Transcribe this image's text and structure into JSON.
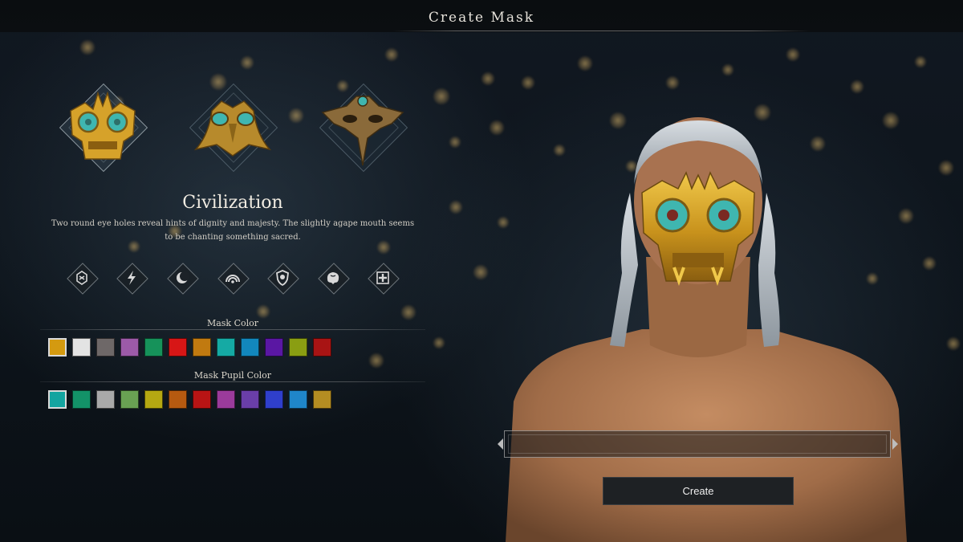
{
  "header": {
    "title": "Create Mask"
  },
  "masks": [
    {
      "icon": "golden-turquoise-eye-mask-icon",
      "selected": true
    },
    {
      "icon": "turquoise-bird-mask-icon",
      "selected": false
    },
    {
      "icon": "bronze-horned-mask-icon",
      "selected": false
    }
  ],
  "selected_mask": {
    "name": "Civilization",
    "description": "Two round eye holes reveal hints of dignity and majesty. The slightly agape mouth seems to be chanting something sacred."
  },
  "attribute_icons": [
    "knot-icon",
    "lightning-icon",
    "moon-icon",
    "rainbow-arc-icon",
    "shield-icon",
    "brain-icon",
    "medical-cross-icon"
  ],
  "mask_color": {
    "label": "Mask Color",
    "selected_index": 0,
    "swatches": [
      "#d49a10",
      "#e3e3e3",
      "#6e6868",
      "#9c5aa8",
      "#16925a",
      "#d71616",
      "#c17a10",
      "#15aaa4",
      "#1287bd",
      "#5a17a3",
      "#8a9e12",
      "#a81414"
    ]
  },
  "pupil_color": {
    "label": "Mask Pupil Color",
    "selected_index": 0,
    "swatches": [
      "#14a4a0",
      "#139268",
      "#a9a9a9",
      "#69a153",
      "#b5a812",
      "#b65a10",
      "#b81414",
      "#9b3b9b",
      "#6a3ea8",
      "#2f3fcc",
      "#1f86c9",
      "#b48d22"
    ]
  },
  "name_field": {
    "value": ""
  },
  "create_button": {
    "label": "Create"
  },
  "colors": {
    "gold": "#c8961e",
    "turquoise": "#3fb6b0",
    "skin": "#b07a55"
  }
}
